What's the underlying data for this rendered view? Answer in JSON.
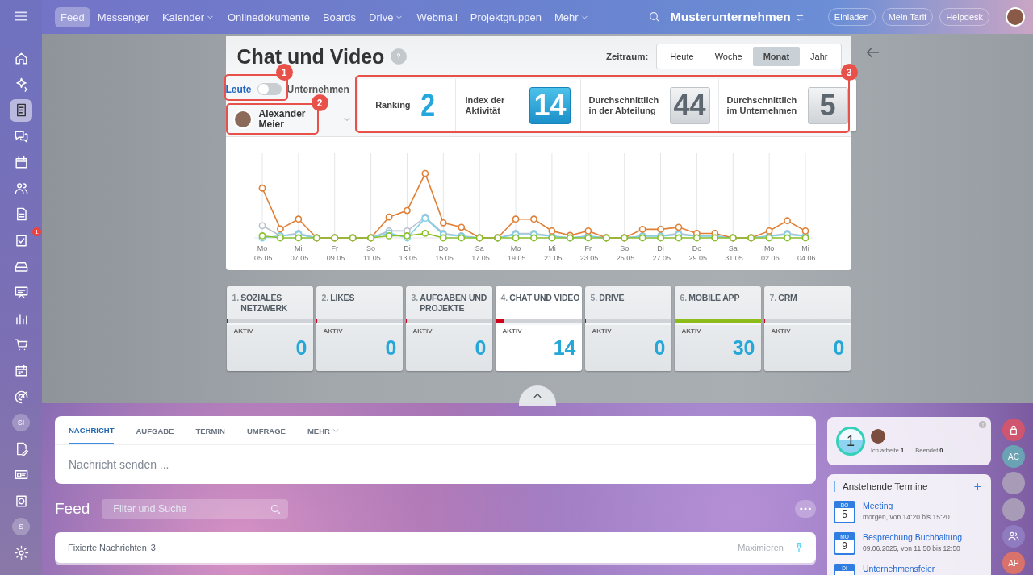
{
  "sidebar": {
    "items": [
      {
        "kind": "icon",
        "selected": false
      },
      {
        "kind": "icon",
        "selected": false
      },
      {
        "kind": "icon",
        "selected": true
      },
      {
        "kind": "icon",
        "selected": false
      },
      {
        "kind": "icon",
        "selected": false
      },
      {
        "kind": "icon",
        "selected": false
      },
      {
        "kind": "icon",
        "selected": false
      },
      {
        "kind": "icon",
        "selected": false,
        "badge": "1"
      },
      {
        "kind": "icon",
        "selected": false
      },
      {
        "kind": "icon",
        "selected": false
      },
      {
        "kind": "icon",
        "selected": false
      },
      {
        "kind": "icon",
        "selected": false
      },
      {
        "kind": "icon",
        "selected": false
      },
      {
        "kind": "icon",
        "selected": false
      },
      {
        "kind": "avatar",
        "label": "SI",
        "selected": false
      },
      {
        "kind": "icon",
        "selected": false
      },
      {
        "kind": "icon",
        "selected": false
      },
      {
        "kind": "icon",
        "selected": false
      },
      {
        "kind": "avatar",
        "label": "S",
        "selected": false
      },
      {
        "kind": "icon",
        "selected": false
      }
    ]
  },
  "topbar": {
    "menu": [
      {
        "label": "Feed",
        "selected": true,
        "dropdown": false
      },
      {
        "label": "Messenger",
        "selected": false,
        "dropdown": false
      },
      {
        "label": "Kalender",
        "selected": false,
        "dropdown": true
      },
      {
        "label": "Onlinedokumente",
        "selected": false,
        "dropdown": false
      },
      {
        "label": "Boards",
        "selected": false,
        "dropdown": false
      },
      {
        "label": "Drive",
        "selected": false,
        "dropdown": true
      },
      {
        "label": "Webmail",
        "selected": false,
        "dropdown": false
      },
      {
        "label": "Projektgruppen",
        "selected": false,
        "dropdown": false
      },
      {
        "label": "Mehr",
        "selected": false,
        "dropdown": true
      }
    ],
    "company": "Musterunternehmen",
    "buttons": [
      "Einladen",
      "Mein Tarif",
      "Helpdesk"
    ]
  },
  "panel": {
    "title": "Chat und Video",
    "period_label": "Zeitraum:",
    "periods": [
      {
        "label": "Heute",
        "selected": false
      },
      {
        "label": "Woche",
        "selected": false
      },
      {
        "label": "Monat",
        "selected": true
      },
      {
        "label": "Jahr",
        "selected": false
      }
    ],
    "toggle": {
      "left_label": "Leute",
      "right_label": "Unternehmen",
      "on": false
    },
    "user": {
      "name": "Alexander Meier"
    },
    "stats": [
      {
        "kind": "plain",
        "label": "Ranking",
        "value": "2"
      },
      {
        "kind": "highlight",
        "label": "Index der Aktivität",
        "value": "14"
      },
      {
        "kind": "tile",
        "label": "Durchschnittlich in der Abteilung",
        "value": "44"
      },
      {
        "kind": "tile",
        "label": "Durchschnittlich im Unternehmen",
        "value": "5"
      }
    ],
    "callouts": [
      "1",
      "2",
      "3"
    ],
    "x_labels": [
      {
        "day": "Mo",
        "date": "05.05"
      },
      {
        "day": "Mi",
        "date": "07.05"
      },
      {
        "day": "Fr",
        "date": "09.05"
      },
      {
        "day": "So",
        "date": "11.05"
      },
      {
        "day": "Di",
        "date": "13.05"
      },
      {
        "day": "Do",
        "date": "15.05"
      },
      {
        "day": "Sa",
        "date": "17.05"
      },
      {
        "day": "Mo",
        "date": "19.05"
      },
      {
        "day": "Mi",
        "date": "21.05"
      },
      {
        "day": "Fr",
        "date": "23.05"
      },
      {
        "day": "So",
        "date": "25.05"
      },
      {
        "day": "Di",
        "date": "27.05"
      },
      {
        "day": "Do",
        "date": "29.05"
      },
      {
        "day": "Sa",
        "date": "31.05"
      },
      {
        "day": "Mo",
        "date": "02.06"
      },
      {
        "day": "Mi",
        "date": "04.06"
      }
    ]
  },
  "cards": [
    {
      "number": "1.",
      "title": "SOZIALES NETZWERK",
      "status": "AKTIV",
      "value": "0",
      "level": 0.01,
      "color": "#d0021b",
      "selected": false
    },
    {
      "number": "2.",
      "title": "LIKES",
      "status": "AKTIV",
      "value": "0",
      "level": 0.01,
      "color": "#d0021b",
      "selected": false
    },
    {
      "number": "3.",
      "title": "AUFGABEN UND PROJEKTE",
      "status": "AKTIV",
      "value": "0",
      "level": 0.01,
      "color": "#d0021b",
      "selected": false
    },
    {
      "number": "4.",
      "title": "CHAT UND VIDEO",
      "status": "AKTIV",
      "value": "14",
      "level": 0.1,
      "color": "#d0021b",
      "selected": true
    },
    {
      "number": "5.",
      "title": "DRIVE",
      "status": "AKTIV",
      "value": "0",
      "level": 0.01,
      "color": "#d0021b",
      "selected": false
    },
    {
      "number": "6.",
      "title": "MOBILE APP",
      "status": "AKTIV",
      "value": "30",
      "level": 1,
      "color": "#8dbb1a",
      "selected": false
    },
    {
      "number": "7.",
      "title": "CRM",
      "status": "AKTIV",
      "value": "0",
      "level": 0.01,
      "color": "#d0021b",
      "selected": false
    }
  ],
  "composer": {
    "tabs": [
      {
        "label": "NACHRICHT",
        "selected": true,
        "dropdown": false
      },
      {
        "label": "AUFGABE",
        "selected": false,
        "dropdown": false
      },
      {
        "label": "TERMIN",
        "selected": false,
        "dropdown": false
      },
      {
        "label": "UMFRAGE",
        "selected": false,
        "dropdown": false
      },
      {
        "label": "MEHR",
        "selected": false,
        "dropdown": true
      }
    ],
    "placeholder": "Nachricht senden ..."
  },
  "feed": {
    "title": "Feed",
    "search_placeholder": "Filter und Suche",
    "pinned_label": "Fixierte Nachrichten",
    "pinned_count": "3",
    "maximize": "Maximieren"
  },
  "timer": {
    "value": "1",
    "working_label": "Ich arbeite",
    "working_count": "1",
    "done_label": "Beendet",
    "done_count": "0"
  },
  "events": {
    "title": "Anstehende Termine",
    "items": [
      {
        "weekday": "DO",
        "day": "5",
        "title": "Meeting",
        "time": "morgen, von 14:20 bis 15:20"
      },
      {
        "weekday": "MO",
        "day": "9",
        "title": "Besprechung Buchhaltung",
        "time": "09.06.2025, von 11:50 bis 12:50"
      },
      {
        "weekday": "DI",
        "title": "Unternehmensfeier"
      }
    ]
  },
  "right_rail": [
    {
      "kind": "lock"
    },
    {
      "kind": "initials",
      "label": "AC"
    },
    {
      "kind": "photo"
    },
    {
      "kind": "photo"
    },
    {
      "kind": "group"
    },
    {
      "kind": "initials",
      "label": "AP"
    }
  ]
}
